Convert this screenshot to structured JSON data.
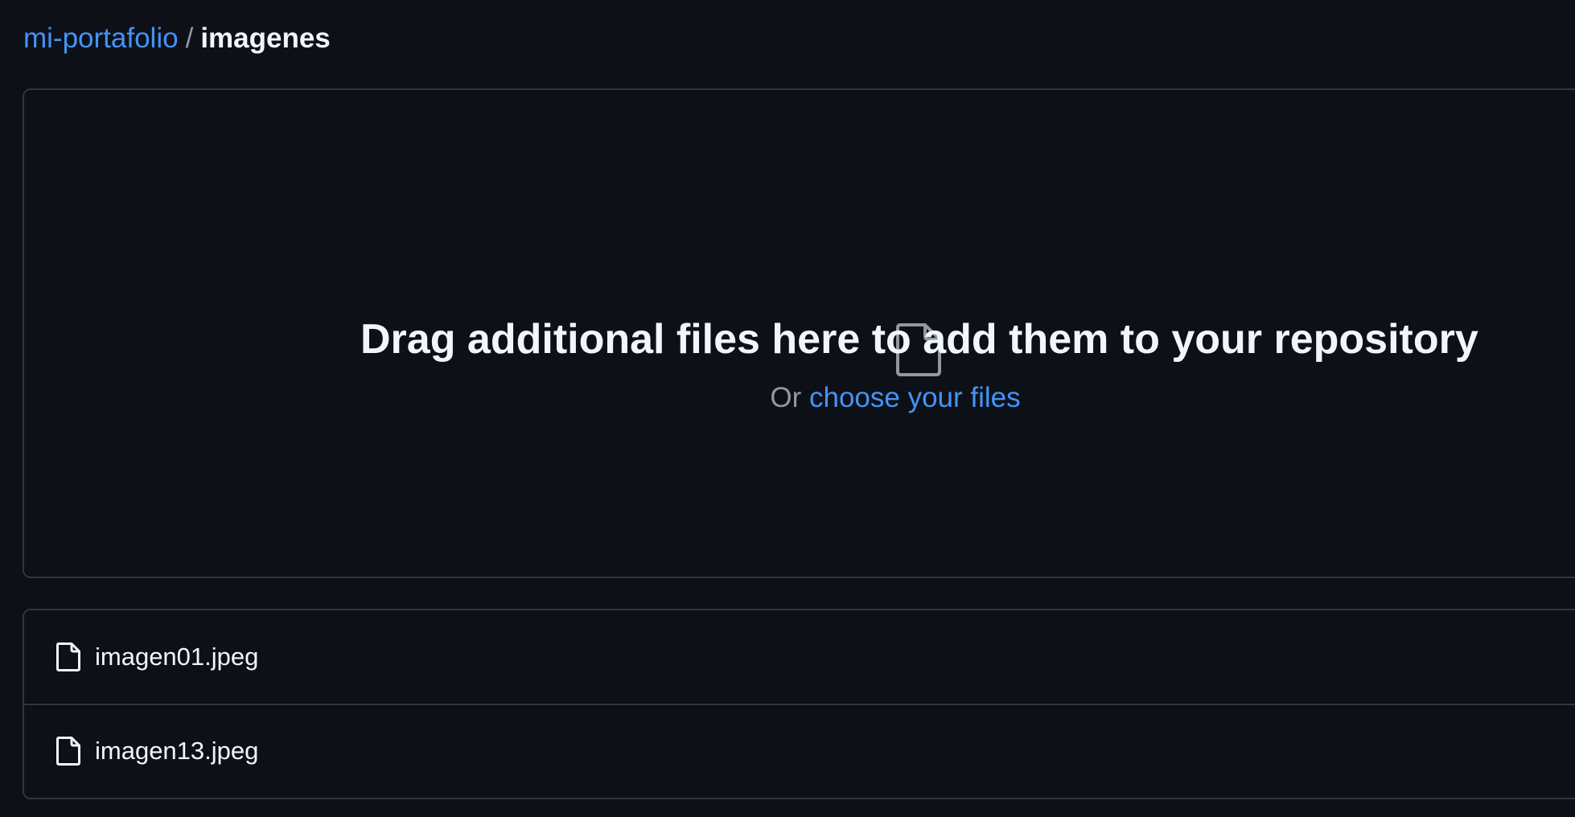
{
  "breadcrumb": {
    "repo": "mi-portafolio",
    "separator": "/",
    "directory": "imagenes"
  },
  "dropzone": {
    "icon": "file-icon",
    "title": "Drag additional files here to add them to your repository",
    "subtitle_prefix": "Or",
    "subtitle_link": "choose your files"
  },
  "files": [
    {
      "name": "imagen01.jpeg",
      "icon": "file-icon"
    },
    {
      "name": "imagen13.jpeg",
      "icon": "file-icon"
    }
  ],
  "colors": {
    "background": "#0d1117",
    "border": "#30363d",
    "link": "#4493f8",
    "text": "#f0f6fc",
    "muted": "#9198a1"
  }
}
